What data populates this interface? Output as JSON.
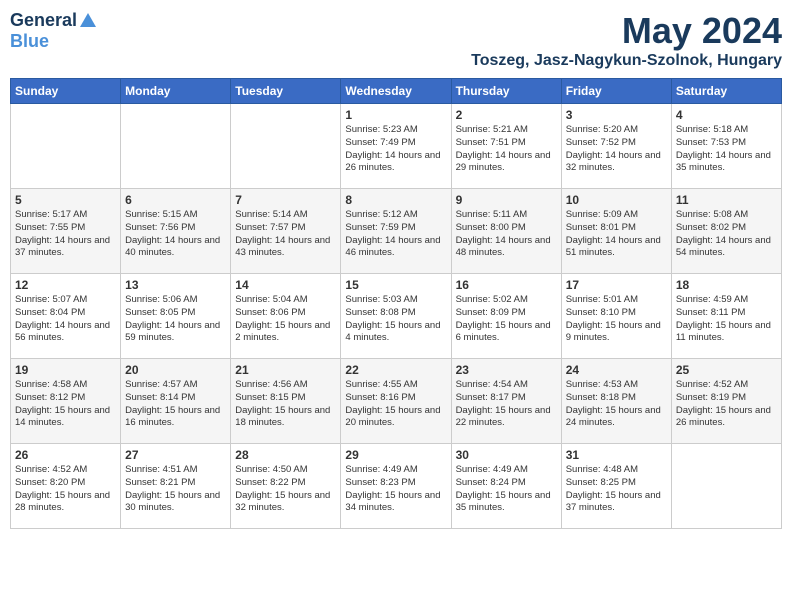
{
  "header": {
    "logo_general": "General",
    "logo_blue": "Blue",
    "month_year": "May 2024",
    "location": "Toszeg, Jasz-Nagykun-Szolnok, Hungary"
  },
  "days_of_week": [
    "Sunday",
    "Monday",
    "Tuesday",
    "Wednesday",
    "Thursday",
    "Friday",
    "Saturday"
  ],
  "weeks": [
    [
      {
        "num": "",
        "sunrise": "",
        "sunset": "",
        "daylight": ""
      },
      {
        "num": "",
        "sunrise": "",
        "sunset": "",
        "daylight": ""
      },
      {
        "num": "",
        "sunrise": "",
        "sunset": "",
        "daylight": ""
      },
      {
        "num": "1",
        "sunrise": "Sunrise: 5:23 AM",
        "sunset": "Sunset: 7:49 PM",
        "daylight": "Daylight: 14 hours and 26 minutes."
      },
      {
        "num": "2",
        "sunrise": "Sunrise: 5:21 AM",
        "sunset": "Sunset: 7:51 PM",
        "daylight": "Daylight: 14 hours and 29 minutes."
      },
      {
        "num": "3",
        "sunrise": "Sunrise: 5:20 AM",
        "sunset": "Sunset: 7:52 PM",
        "daylight": "Daylight: 14 hours and 32 minutes."
      },
      {
        "num": "4",
        "sunrise": "Sunrise: 5:18 AM",
        "sunset": "Sunset: 7:53 PM",
        "daylight": "Daylight: 14 hours and 35 minutes."
      }
    ],
    [
      {
        "num": "5",
        "sunrise": "Sunrise: 5:17 AM",
        "sunset": "Sunset: 7:55 PM",
        "daylight": "Daylight: 14 hours and 37 minutes."
      },
      {
        "num": "6",
        "sunrise": "Sunrise: 5:15 AM",
        "sunset": "Sunset: 7:56 PM",
        "daylight": "Daylight: 14 hours and 40 minutes."
      },
      {
        "num": "7",
        "sunrise": "Sunrise: 5:14 AM",
        "sunset": "Sunset: 7:57 PM",
        "daylight": "Daylight: 14 hours and 43 minutes."
      },
      {
        "num": "8",
        "sunrise": "Sunrise: 5:12 AM",
        "sunset": "Sunset: 7:59 PM",
        "daylight": "Daylight: 14 hours and 46 minutes."
      },
      {
        "num": "9",
        "sunrise": "Sunrise: 5:11 AM",
        "sunset": "Sunset: 8:00 PM",
        "daylight": "Daylight: 14 hours and 48 minutes."
      },
      {
        "num": "10",
        "sunrise": "Sunrise: 5:09 AM",
        "sunset": "Sunset: 8:01 PM",
        "daylight": "Daylight: 14 hours and 51 minutes."
      },
      {
        "num": "11",
        "sunrise": "Sunrise: 5:08 AM",
        "sunset": "Sunset: 8:02 PM",
        "daylight": "Daylight: 14 hours and 54 minutes."
      }
    ],
    [
      {
        "num": "12",
        "sunrise": "Sunrise: 5:07 AM",
        "sunset": "Sunset: 8:04 PM",
        "daylight": "Daylight: 14 hours and 56 minutes."
      },
      {
        "num": "13",
        "sunrise": "Sunrise: 5:06 AM",
        "sunset": "Sunset: 8:05 PM",
        "daylight": "Daylight: 14 hours and 59 minutes."
      },
      {
        "num": "14",
        "sunrise": "Sunrise: 5:04 AM",
        "sunset": "Sunset: 8:06 PM",
        "daylight": "Daylight: 15 hours and 2 minutes."
      },
      {
        "num": "15",
        "sunrise": "Sunrise: 5:03 AM",
        "sunset": "Sunset: 8:08 PM",
        "daylight": "Daylight: 15 hours and 4 minutes."
      },
      {
        "num": "16",
        "sunrise": "Sunrise: 5:02 AM",
        "sunset": "Sunset: 8:09 PM",
        "daylight": "Daylight: 15 hours and 6 minutes."
      },
      {
        "num": "17",
        "sunrise": "Sunrise: 5:01 AM",
        "sunset": "Sunset: 8:10 PM",
        "daylight": "Daylight: 15 hours and 9 minutes."
      },
      {
        "num": "18",
        "sunrise": "Sunrise: 4:59 AM",
        "sunset": "Sunset: 8:11 PM",
        "daylight": "Daylight: 15 hours and 11 minutes."
      }
    ],
    [
      {
        "num": "19",
        "sunrise": "Sunrise: 4:58 AM",
        "sunset": "Sunset: 8:12 PM",
        "daylight": "Daylight: 15 hours and 14 minutes."
      },
      {
        "num": "20",
        "sunrise": "Sunrise: 4:57 AM",
        "sunset": "Sunset: 8:14 PM",
        "daylight": "Daylight: 15 hours and 16 minutes."
      },
      {
        "num": "21",
        "sunrise": "Sunrise: 4:56 AM",
        "sunset": "Sunset: 8:15 PM",
        "daylight": "Daylight: 15 hours and 18 minutes."
      },
      {
        "num": "22",
        "sunrise": "Sunrise: 4:55 AM",
        "sunset": "Sunset: 8:16 PM",
        "daylight": "Daylight: 15 hours and 20 minutes."
      },
      {
        "num": "23",
        "sunrise": "Sunrise: 4:54 AM",
        "sunset": "Sunset: 8:17 PM",
        "daylight": "Daylight: 15 hours and 22 minutes."
      },
      {
        "num": "24",
        "sunrise": "Sunrise: 4:53 AM",
        "sunset": "Sunset: 8:18 PM",
        "daylight": "Daylight: 15 hours and 24 minutes."
      },
      {
        "num": "25",
        "sunrise": "Sunrise: 4:52 AM",
        "sunset": "Sunset: 8:19 PM",
        "daylight": "Daylight: 15 hours and 26 minutes."
      }
    ],
    [
      {
        "num": "26",
        "sunrise": "Sunrise: 4:52 AM",
        "sunset": "Sunset: 8:20 PM",
        "daylight": "Daylight: 15 hours and 28 minutes."
      },
      {
        "num": "27",
        "sunrise": "Sunrise: 4:51 AM",
        "sunset": "Sunset: 8:21 PM",
        "daylight": "Daylight: 15 hours and 30 minutes."
      },
      {
        "num": "28",
        "sunrise": "Sunrise: 4:50 AM",
        "sunset": "Sunset: 8:22 PM",
        "daylight": "Daylight: 15 hours and 32 minutes."
      },
      {
        "num": "29",
        "sunrise": "Sunrise: 4:49 AM",
        "sunset": "Sunset: 8:23 PM",
        "daylight": "Daylight: 15 hours and 34 minutes."
      },
      {
        "num": "30",
        "sunrise": "Sunrise: 4:49 AM",
        "sunset": "Sunset: 8:24 PM",
        "daylight": "Daylight: 15 hours and 35 minutes."
      },
      {
        "num": "31",
        "sunrise": "Sunrise: 4:48 AM",
        "sunset": "Sunset: 8:25 PM",
        "daylight": "Daylight: 15 hours and 37 minutes."
      },
      {
        "num": "",
        "sunrise": "",
        "sunset": "",
        "daylight": ""
      }
    ]
  ]
}
